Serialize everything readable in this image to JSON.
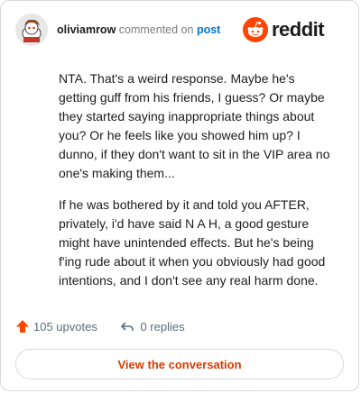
{
  "comment": {
    "username": "oliviamrow",
    "action_text": "commented on",
    "target_link": "post",
    "paragraphs": [
      "NTA. That's a weird response. Maybe he's getting guff from his friends, I guess? Or maybe they started saying inappropriate things about you? Or he feels like you showed him up? I dunno, if they don't want to sit in the VIP area no one's making them...",
      "If he was bothered by it and told you AFTER, privately, i'd have said N A H, a good gesture might have unintended effects. But he's being f'ing rude about it when you obviously had good intentions, and I don't see any real harm done."
    ],
    "upvotes": "105 upvotes",
    "replies": "0 replies"
  },
  "brand": {
    "name": "reddit",
    "icon": "reddit-logo-icon",
    "color": "#ff4500"
  },
  "cta_label": "View the conversation",
  "colors": {
    "upvote": "#ff4500",
    "link": "#0079d3",
    "cta": "#d93a00"
  }
}
